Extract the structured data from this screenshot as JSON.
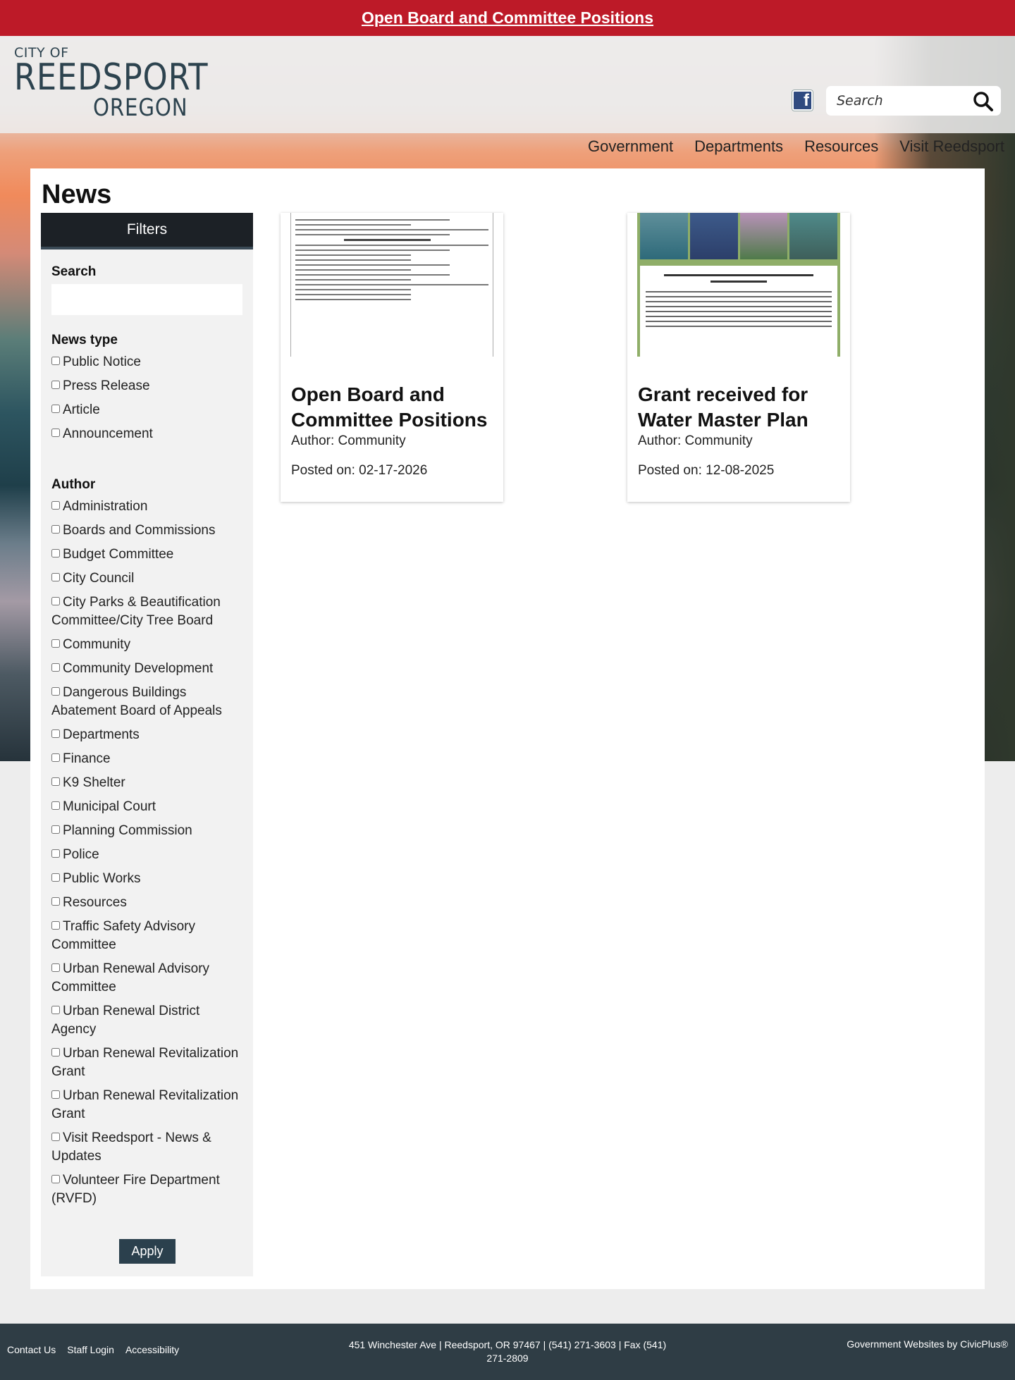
{
  "alert": {
    "text": "Open Board and Committee Positions"
  },
  "header": {
    "logo": {
      "line1": "CITY OF",
      "line2": "REEDSPORT",
      "line3": "OREGON"
    },
    "search_placeholder": "Search",
    "nav": [
      "Government",
      "Departments",
      "Resources",
      "Visit Reedsport"
    ]
  },
  "page": {
    "title": "News"
  },
  "filters": {
    "heading": "Filters",
    "search_label": "Search",
    "search_value": "",
    "news_type": {
      "label": "News type",
      "options": [
        "Public Notice",
        "Press Release",
        "Article",
        "Announcement"
      ]
    },
    "author": {
      "label": "Author",
      "options": [
        "Administration",
        "Boards and Commissions",
        "Budget Committee",
        "City Council",
        "City Parks & Beautification Committee/City Tree Board",
        "Community",
        "Community Development",
        "Dangerous Buildings Abatement Board of Appeals",
        "Departments",
        "Finance",
        "K9 Shelter",
        "Municipal Court",
        "Planning Commission",
        "Police",
        "Public Works",
        "Resources",
        "Traffic Safety Advisory Committee",
        "Urban Renewal Advisory Committee",
        "Urban Renewal District Agency",
        "Urban Renewal Revitalization Grant",
        "Urban Renewal Revitalization Grant",
        "Visit Reedsport - News & Updates",
        "Volunteer Fire Department (RVFD)"
      ]
    },
    "apply_label": "Apply"
  },
  "news": [
    {
      "title": "Open Board and Committee Positions",
      "author": "Author: Community",
      "posted": "Posted on: 02-17-2026"
    },
    {
      "title": "Grant received for Water Master Plan",
      "author": "Author: Community",
      "posted": "Posted on: 12-08-2025"
    }
  ],
  "footer": {
    "links": [
      "Contact Us",
      "Staff Login",
      "Accessibility"
    ],
    "address": "451 Winchester Ave | Reedsport, OR 97467 | (541) 271-3603 | Fax (541) 271-2809",
    "credit": "Government Websites by CivicPlus®"
  },
  "colors": {
    "alert_bg": "#bd1a28",
    "logo": "#2d434f",
    "filters_head": "#1c2126",
    "apply_button": "#2b404d",
    "footer_bg": "#2f3d45",
    "facebook": "#2f4a80"
  },
  "icons": {
    "facebook": "facebook-icon",
    "search": "search-icon"
  }
}
